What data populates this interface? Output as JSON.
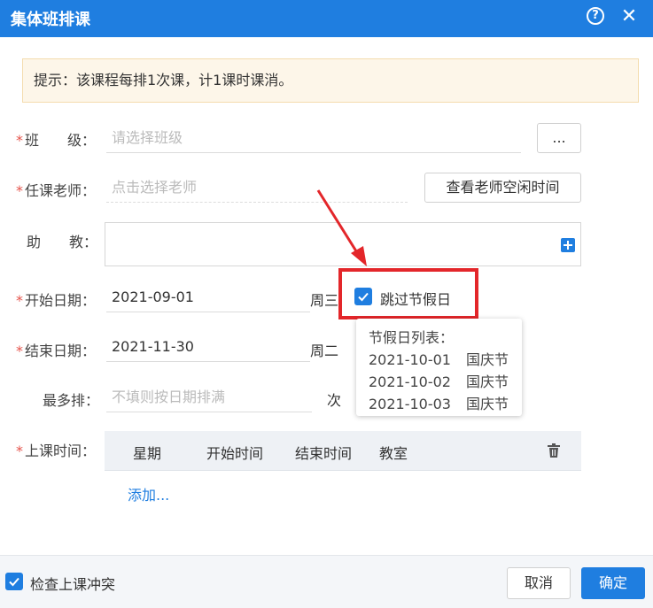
{
  "dialog": {
    "title": "集体班排课"
  },
  "hint": {
    "text": "提示：该课程每排1次课，计1课时课消。"
  },
  "form": {
    "class": {
      "label": "班　　级：",
      "placeholder": "请选择班级",
      "browse_button": "..."
    },
    "teacher": {
      "label": "任课老师：",
      "placeholder": "点击选择老师",
      "button": "查看老师空闲时间"
    },
    "assistant": {
      "label": "助　　教："
    },
    "start_date": {
      "label": "开始日期：",
      "value": "2021-09-01",
      "weekday": "周三"
    },
    "end_date": {
      "label": "结束日期：",
      "value": "2021-11-30",
      "weekday": "周二"
    },
    "max_sessions": {
      "label": "最多排：",
      "placeholder": "不填则按日期排满",
      "unit": "次"
    },
    "skip_holidays": {
      "label": "跳过节假日",
      "checked": true
    },
    "schedule": {
      "label": "上课时间：",
      "columns": [
        "星期",
        "开始时间",
        "结束时间",
        "教室"
      ],
      "add_link": "添加..."
    }
  },
  "holiday_popover": {
    "title": "节假日列表：",
    "items": [
      {
        "date": "2021-10-01",
        "name": "国庆节"
      },
      {
        "date": "2021-10-02",
        "name": "国庆节"
      },
      {
        "date": "2021-10-03",
        "name": "国庆节"
      }
    ]
  },
  "footer": {
    "check_conflict_label": "检查上课冲突",
    "check_conflict_checked": true,
    "cancel": "取消",
    "confirm": "确定"
  },
  "colors": {
    "primary": "#1f7ee0",
    "required": "#e5534b",
    "highlight": "#e3262a",
    "hint_bg": "#fdf6e9"
  },
  "icons": {
    "help": "help-icon",
    "close": "close-icon",
    "add": "plus-icon",
    "delete": "trash-icon",
    "check": "check-icon"
  }
}
